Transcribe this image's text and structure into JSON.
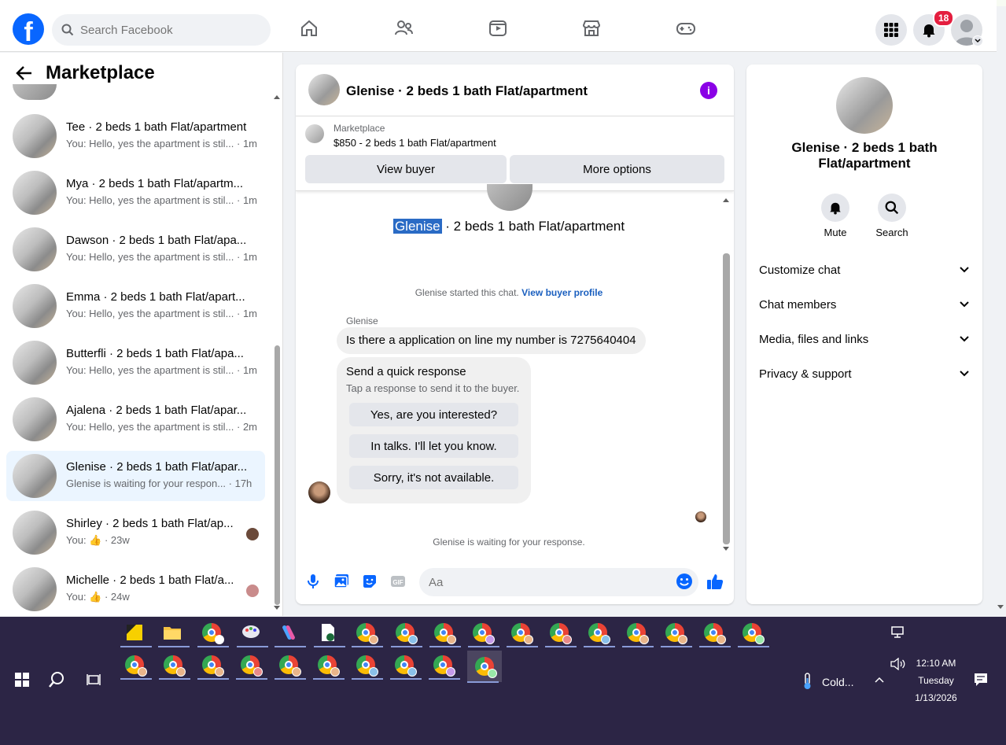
{
  "topnav": {
    "logo": "f",
    "search_placeholder": "Search Facebook",
    "notification_count": "18"
  },
  "left": {
    "title": "Marketplace",
    "conversations": [
      {
        "name": "Tee · 2 beds 1 bath Flat/apartment",
        "preview": "You: Hello, yes the apartment is stil... · 1m",
        "active": false
      },
      {
        "name": "Mya · 2 beds 1 bath Flat/apartm...",
        "preview": "You: Hello, yes the apartment is stil... · 1m",
        "active": false
      },
      {
        "name": "Dawson · 2 beds 1 bath Flat/apa...",
        "preview": "You: Hello, yes the apartment is stil... · 1m",
        "active": false
      },
      {
        "name": "Emma · 2 beds 1 bath Flat/apart...",
        "preview": "You: Hello, yes the apartment is stil... · 1m",
        "active": false
      },
      {
        "name": "Butterfli · 2 beds 1 bath Flat/apa...",
        "preview": "You: Hello, yes the apartment is stil... · 1m",
        "active": false
      },
      {
        "name": "Ajalena · 2 beds 1 bath Flat/apar...",
        "preview": "You: Hello, yes the apartment is stil... · 2m",
        "active": false
      },
      {
        "name": "Glenise · 2 beds 1 bath Flat/apar...",
        "preview": "Glenise is waiting for your respon... · 17h",
        "active": true
      },
      {
        "name": "Shirley · 2 beds 1 bath Flat/ap...",
        "preview": "You: 👍 · 23w",
        "active": false
      },
      {
        "name": "Michelle · 2 beds 1 bath Flat/a...",
        "preview": "You: 👍 · 24w",
        "active": false
      }
    ]
  },
  "chat": {
    "title": "Glenise · 2 beds 1 bath Flat/apartment",
    "marketplace_label": "Marketplace",
    "listing": "$850 - 2 beds 1 bath Flat/apartment",
    "view_buyer": "View buyer",
    "more_options": "More options",
    "conv_title_highlight": "Glenise",
    "conv_title_rest": " · 2 beds 1 bath Flat/apartment",
    "started_text": "Glenise started this chat.",
    "view_profile": "View buyer profile",
    "sender": "Glenise",
    "message": "Is there a application on line my number is 7275640404",
    "quick": {
      "heading": "Send a quick response",
      "sub": "Tap a response to send it to the buyer.",
      "options": [
        "Yes, are you interested?",
        "In talks. I'll let you know.",
        "Sorry, it's not available."
      ]
    },
    "waiting": "Glenise is waiting for your response.",
    "composer_placeholder": "Aa"
  },
  "right": {
    "name": "Glenise · 2 beds 1 bath Flat/apartment",
    "mute": "Mute",
    "search": "Search",
    "sections": [
      "Customize chat",
      "Chat members",
      "Media, files and links",
      "Privacy & support"
    ]
  },
  "taskbar": {
    "weather": "Cold...",
    "time": "12:10 AM",
    "day": "Tuesday",
    "date": "1/13/2026"
  }
}
